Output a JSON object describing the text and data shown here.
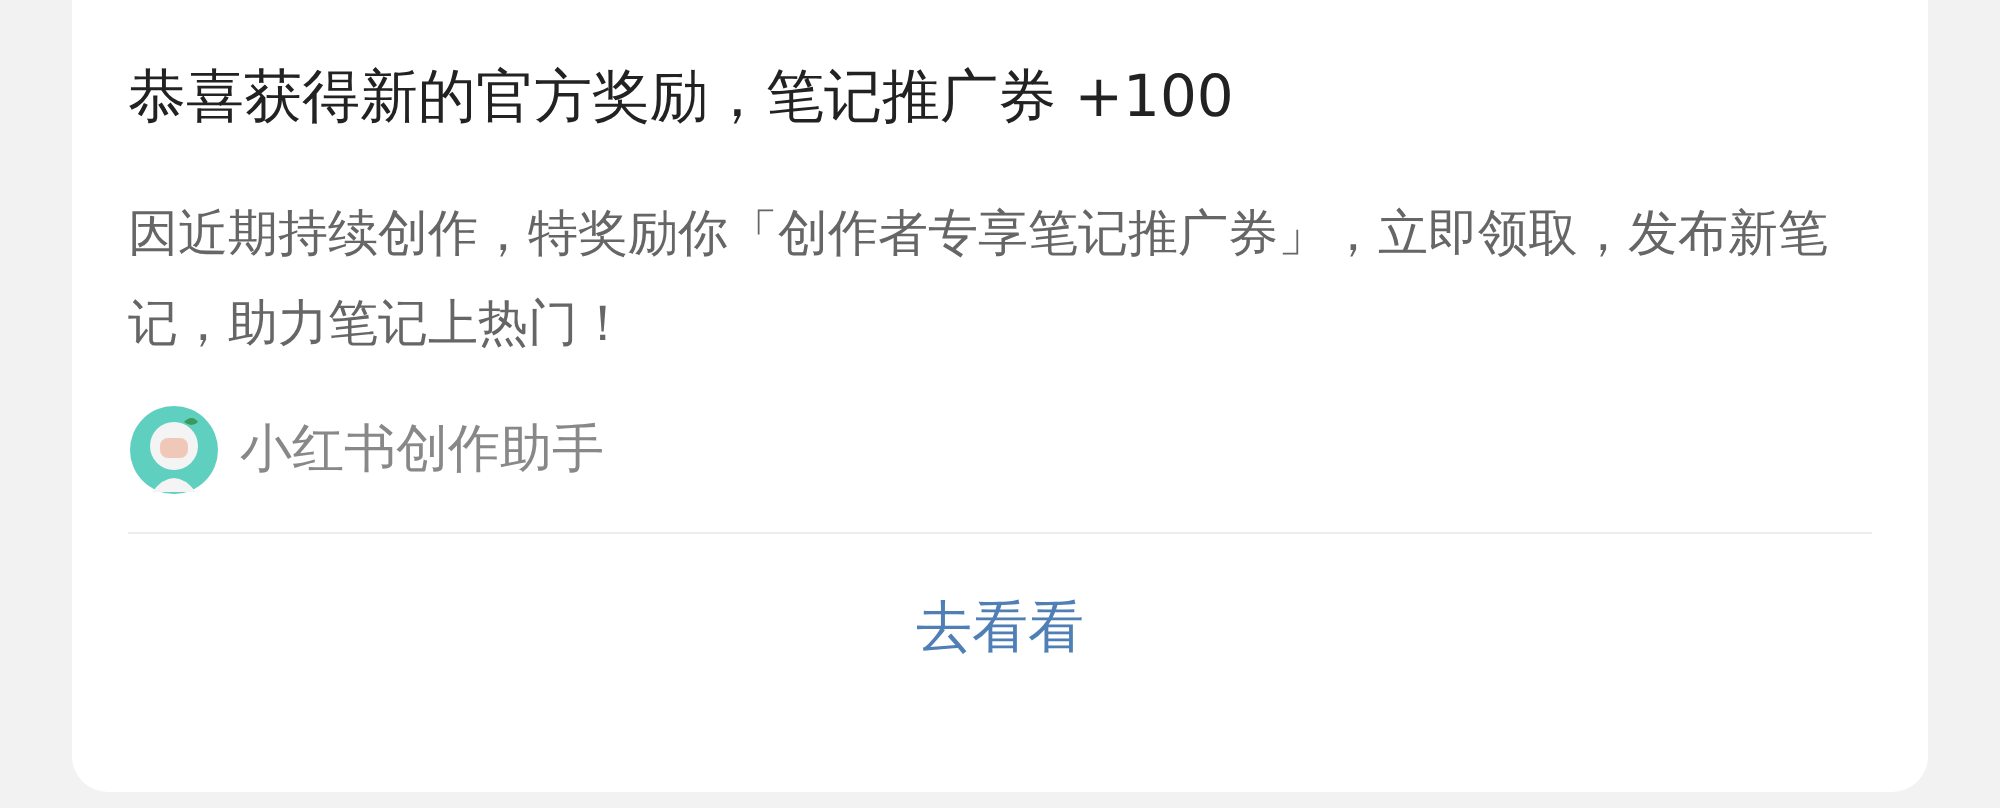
{
  "card": {
    "title": "恭喜获得新的官方奖励，笔记推广券 +100",
    "message": "因近期持续创作，特奖励你「创作者专享笔记推广券」，立即领取，发布新笔记，助力笔记上热门！",
    "sender": {
      "name": "小红书创作助手"
    },
    "action": {
      "label": "去看看"
    }
  }
}
